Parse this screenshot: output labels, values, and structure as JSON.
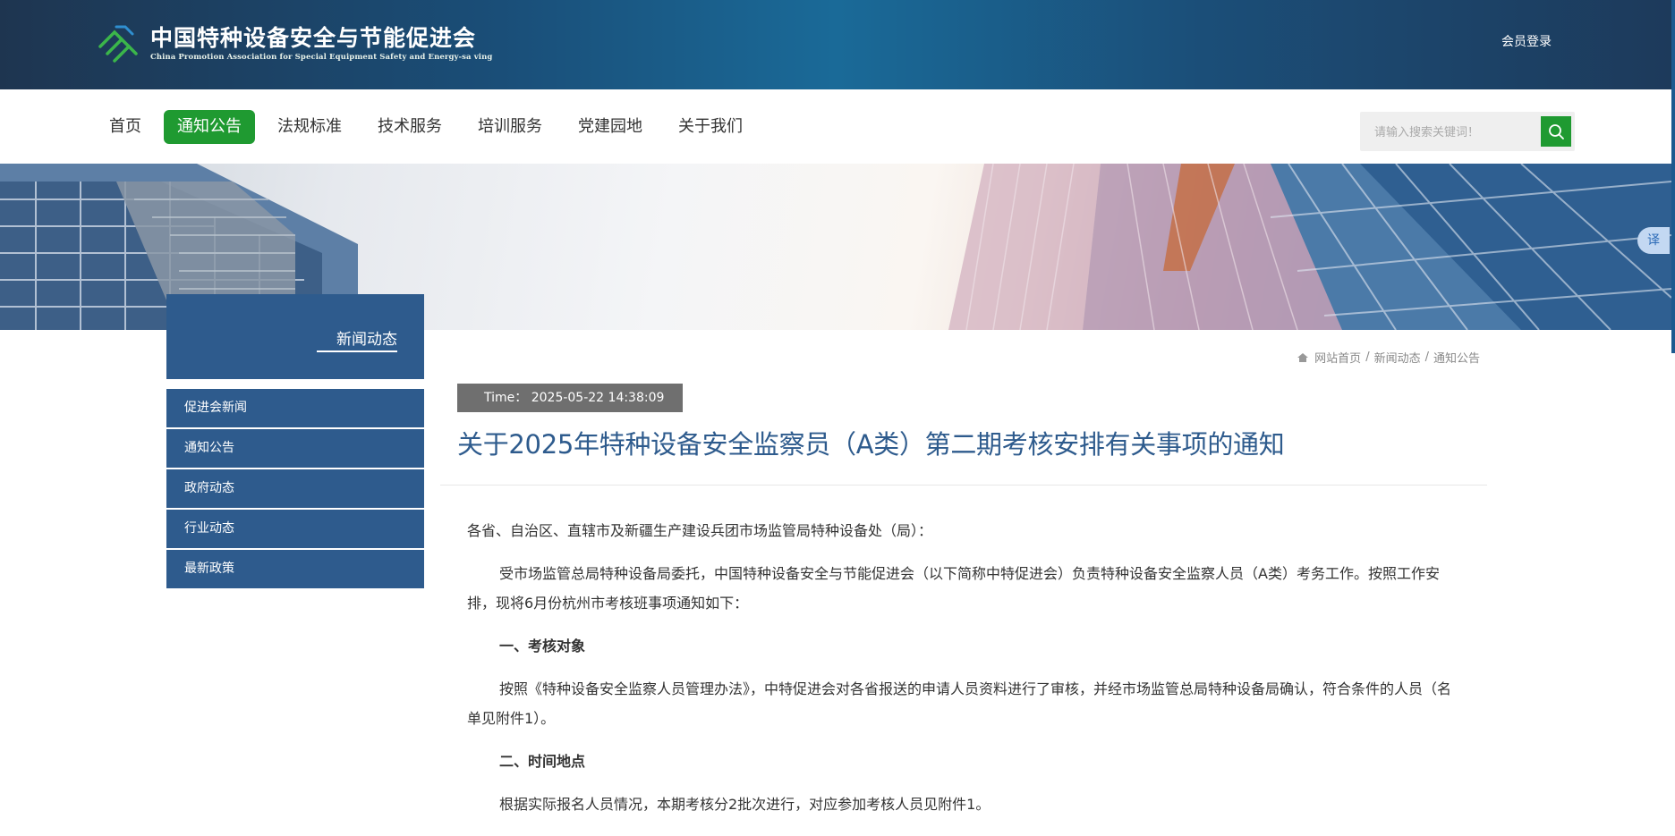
{
  "header": {
    "org_name_cn": "中国特种设备安全与节能促进会",
    "org_name_en": "China Promotion Association for Special Equipment Safety and Energy-sa ving",
    "member_login": "会员登录"
  },
  "nav": {
    "items": [
      {
        "label": "首页",
        "active": false
      },
      {
        "label": "通知公告",
        "active": true
      },
      {
        "label": "法规标准",
        "active": false
      },
      {
        "label": "技术服务",
        "active": false
      },
      {
        "label": "培训服务",
        "active": false
      },
      {
        "label": "党建园地",
        "active": false
      },
      {
        "label": "关于我们",
        "active": false
      }
    ],
    "search_placeholder": "请输入搜索关键词！",
    "accent_color": "#1f9a31"
  },
  "translate_label": "译",
  "sidebar": {
    "title": "新闻动态",
    "items": [
      {
        "label": "促进会新闻"
      },
      {
        "label": "通知公告"
      },
      {
        "label": "政府动态"
      },
      {
        "label": "行业动态"
      },
      {
        "label": "最新政策"
      }
    ],
    "color": "#2e5b8d"
  },
  "breadcrumb": [
    "网站首页",
    "新闻动态",
    "通知公告"
  ],
  "article": {
    "time_label": "Time：",
    "time_value": "2025-05-22 14:38:09",
    "title": "关于2025年特种设备安全监察员（A类）第二期考核安排有关事项的通知",
    "paragraphs": [
      "各省、自治区、直辖市及新疆生产建设兵团市场监管局特种设备处（局）：",
      "受市场监管总局特种设备局委托，中国特种设备安全与节能促进会（以下简称中特促进会）负责特种设备安全监察人员（A类）考务工作。按照工作安排，现将6月份杭州市考核班事项通知如下：",
      "一、考核对象",
      "按照《特种设备安全监察人员管理办法》，中特促进会对各省报送的申请人员资料进行了审核，并经市场监管总局特种设备局确认，符合条件的人员（名单见附件1）。",
      "二、时间地点",
      "根据实际报名人员情况，本期考核分2批次进行，对应参加考核人员见附件1。"
    ]
  }
}
